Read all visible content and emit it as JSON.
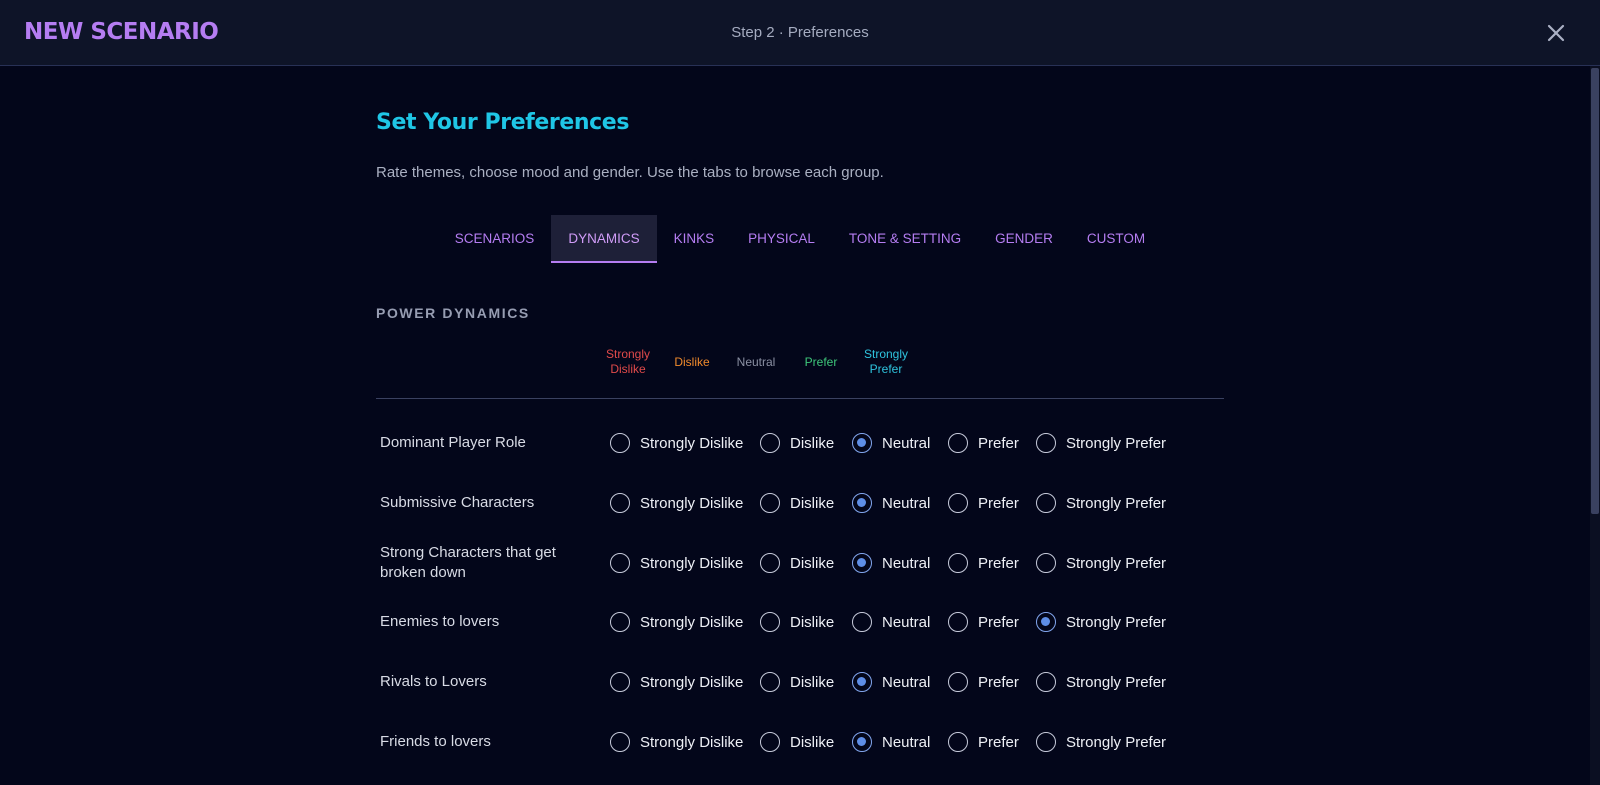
{
  "header": {
    "brand": "NEW SCENARIO",
    "step": "Step 2 · Preferences"
  },
  "page": {
    "title": "Set Your Preferences",
    "subtitle": "Rate themes, choose mood and gender. Use the tabs to browse each group."
  },
  "tabs": [
    {
      "label": "SCENARIOS",
      "active": false
    },
    {
      "label": "DYNAMICS",
      "active": true
    },
    {
      "label": "KINKS",
      "active": false
    },
    {
      "label": "PHYSICAL",
      "active": false
    },
    {
      "label": "TONE & SETTING",
      "active": false
    },
    {
      "label": "GENDER",
      "active": false
    },
    {
      "label": "CUSTOM",
      "active": false
    }
  ],
  "section": {
    "title": "POWER DYNAMICS"
  },
  "legend": [
    {
      "label": "Strongly\nDislike",
      "color": "#e04a4a"
    },
    {
      "label": "Dislike",
      "color": "#f08a2c"
    },
    {
      "label": "Neutral",
      "color": "#8b90a3"
    },
    {
      "label": "Prefer",
      "color": "#3ec77a"
    },
    {
      "label": "Strongly\nPrefer",
      "color": "#2fc4de"
    }
  ],
  "options": [
    "Strongly Dislike",
    "Dislike",
    "Neutral",
    "Prefer",
    "Strongly Prefer"
  ],
  "rows": [
    {
      "label": "Dominant Player Role",
      "selected": "Neutral"
    },
    {
      "label": "Submissive Characters",
      "selected": "Neutral"
    },
    {
      "label": "Strong Characters that get broken down",
      "selected": "Neutral"
    },
    {
      "label": "Enemies to lovers",
      "selected": "Strongly Prefer"
    },
    {
      "label": "Rivals to Lovers",
      "selected": "Neutral"
    },
    {
      "label": "Friends to lovers",
      "selected": "Neutral"
    }
  ],
  "icons": {
    "close": "close-icon"
  },
  "colors": {
    "accent": "#b57df2",
    "title": "#1fc6e6",
    "radio_on": "#5e8ee6"
  }
}
